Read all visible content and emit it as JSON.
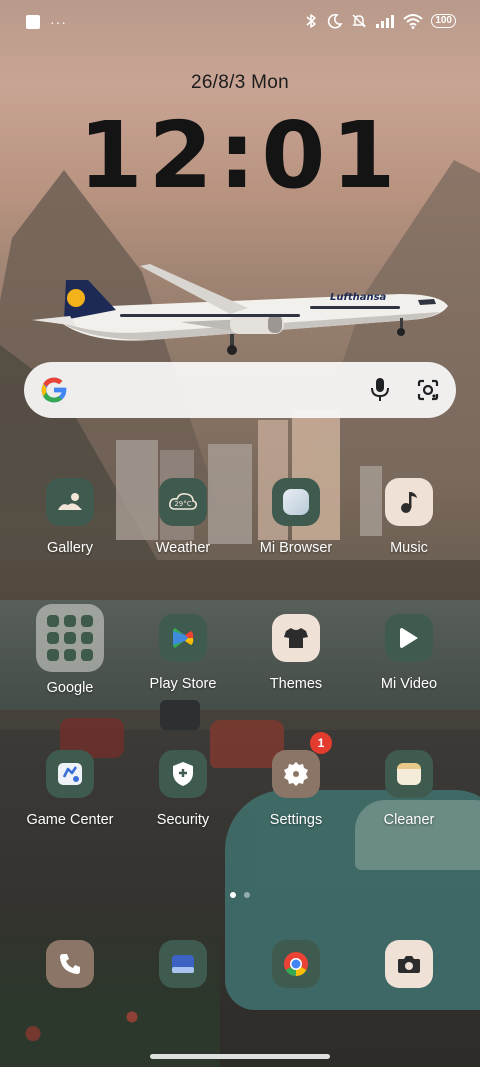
{
  "status_bar": {
    "notification_dots": "···",
    "battery": "100"
  },
  "lockscreen": {
    "date": "26/8/3 Mon",
    "time": "12:01"
  },
  "search_bar": {
    "google_logo": "G"
  },
  "apps": {
    "gallery": "Gallery",
    "weather": "Weather",
    "weather_temp": "29°C",
    "mi_browser": "Mi Browser",
    "music": "Music",
    "google_folder": "Google",
    "play_store": "Play Store",
    "themes": "Themes",
    "mi_video": "Mi Video",
    "game_center": "Game Center",
    "security": "Security",
    "settings": "Settings",
    "settings_badge": "1",
    "cleaner": "Cleaner"
  },
  "plane_livery": "Lufthansa",
  "icons": {
    "gallery": "gallery-icon",
    "weather": "weather-icon",
    "browser": "browser-icon",
    "music": "music-note-icon",
    "play_store": "play-store-icon",
    "themes": "tshirt-icon",
    "mi_video": "play-icon",
    "game_center": "game-center-icon",
    "security": "shield-icon",
    "settings": "gear-icon",
    "cleaner": "cleaner-icon",
    "phone": "phone-icon",
    "messages": "messages-icon",
    "chrome": "chrome-icon",
    "camera": "camera-icon"
  },
  "colors": {
    "icon_green": "#3f5a4e",
    "icon_beige": "#efe1d6",
    "badge_red": "#e43b2f"
  }
}
